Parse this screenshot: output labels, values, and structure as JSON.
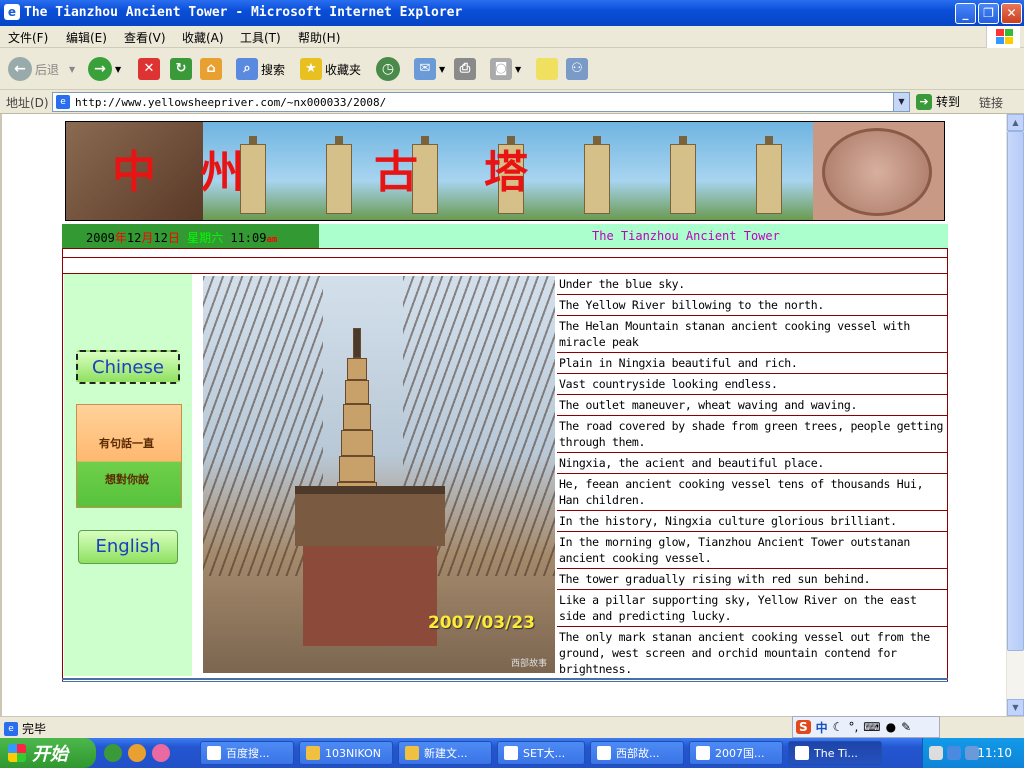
{
  "window": {
    "title": "The Tianzhou Ancient Tower - Microsoft Internet Explorer"
  },
  "menu": [
    "文件(F)",
    "编辑(E)",
    "查看(V)",
    "收藏(A)",
    "工具(T)",
    "帮助(H)"
  ],
  "toolbar": {
    "back": "后退",
    "search": "搜索",
    "favorites": "收藏夹"
  },
  "address": {
    "label": "地址(D)",
    "url": "http://www.yellowsheepriver.com/~nx000033/2008/",
    "go": "转到",
    "links": "链接"
  },
  "page": {
    "banner_chars": [
      "中",
      "州",
      "古",
      "塔"
    ],
    "date": {
      "year": "2009",
      "y_char": "年",
      "month": "12",
      "m_char": "月",
      "day": "12",
      "d_char": "日",
      "weekday": "星期六",
      "time": "11:09",
      "ampm": "am"
    },
    "title": "The Tianzhou Ancient Tower",
    "buttons": {
      "chinese": "Chinese",
      "english": "English"
    },
    "kids_image": {
      "line1": "有句話一直",
      "line2": "想對你說"
    },
    "photo": {
      "date": "2007/03/23",
      "caption": "西部故事"
    },
    "poem": [
      "Under the blue sky.",
      "The Yellow River billowing to the north.",
      "The Helan Mountain stanan ancient cooking vessel with miracle peak",
      "Plain in Ningxia beautiful and rich.",
      "Vast countryside looking endless.",
      "The outlet maneuver, wheat waving and waving.",
      "The road covered by shade from green trees, people getting through them.",
      "Ningxia, the acient and beautiful place.",
      "He, feean ancient cooking vessel tens of thousands Hui, Han children.",
      "In the history, Ningxia culture glorious brilliant.",
      "In the morning glow, Tianzhou Ancient Tower outstanan ancient cooking vessel.",
      "The tower gradually rising with red sun behind.",
      "Like a pillar supporting sky, Yellow River on the east side and predicting lucky.",
      "The only mark stanan ancient cooking vessel out from the ground, west screen and orchid mountain contend for brightness."
    ]
  },
  "status": {
    "text": "完毕"
  },
  "ime": {
    "label": "中"
  },
  "taskbar": {
    "start": "开始",
    "tasks": [
      "百度搜...",
      "103NIKON",
      "新建文...",
      "SET大...",
      "西部故...",
      "2007国...",
      "The Ti..."
    ],
    "clock": "11:10"
  },
  "colors": {
    "date_red": "#ff0000",
    "date_green": "#00a000",
    "title_magenta": "#c000c0",
    "frame_red": "#8b0000"
  }
}
